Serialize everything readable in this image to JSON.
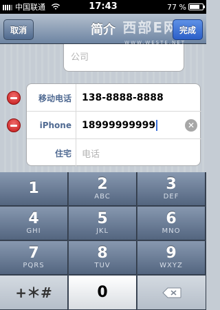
{
  "status_bar": {
    "carrier": "中国联通",
    "time": "17:43",
    "battery": "77 %",
    "battery_level": 0.77
  },
  "nav": {
    "title": "简介",
    "cancel": "取消",
    "done": "完成",
    "watermark": "西部E网",
    "watermark_sub": "WWW.WESTE.NET"
  },
  "form": {
    "company_placeholder": "公司",
    "rows": [
      {
        "label": "移动电话",
        "value": "138-8888-8888"
      },
      {
        "label": "iPhone",
        "value": "18999999999"
      },
      {
        "label": "住宅",
        "placeholder": "电话"
      }
    ]
  },
  "keypad": {
    "keys": [
      {
        "num": "1",
        "letters": ""
      },
      {
        "num": "2",
        "letters": "ABC"
      },
      {
        "num": "3",
        "letters": "DEF"
      },
      {
        "num": "4",
        "letters": "GHI"
      },
      {
        "num": "5",
        "letters": "JKL"
      },
      {
        "num": "6",
        "letters": "MNO"
      },
      {
        "num": "7",
        "letters": "PQRS"
      },
      {
        "num": "8",
        "letters": "TUV"
      },
      {
        "num": "9",
        "letters": "WXYZ"
      },
      {
        "num": "+＊#",
        "letters": ""
      },
      {
        "num": "0",
        "letters": ""
      }
    ]
  },
  "icons": {
    "signal": "signal-icon",
    "wifi": "wifi-icon",
    "battery": "battery-icon",
    "delete": "minus-circle-icon",
    "clear": "clear-icon",
    "backspace": "backspace-icon"
  }
}
